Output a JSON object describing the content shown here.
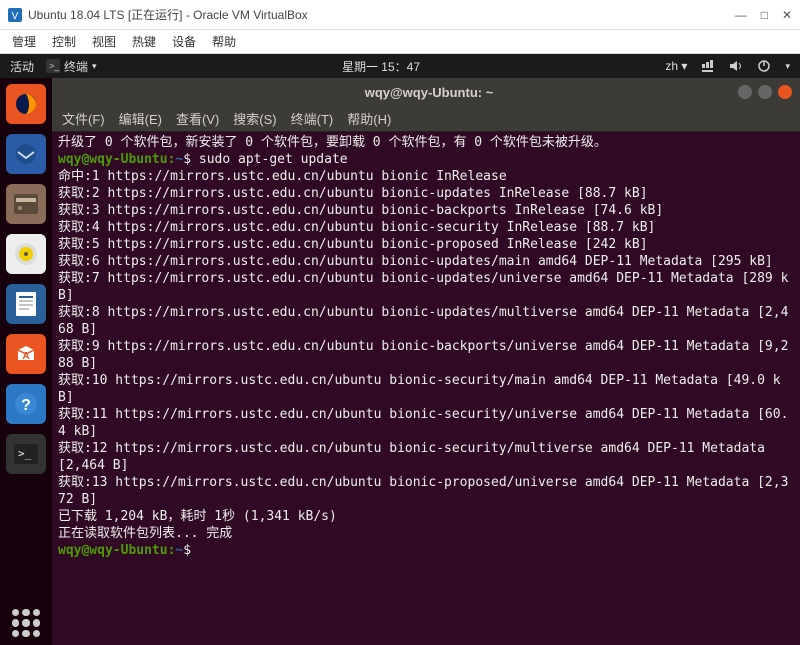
{
  "virtualbox": {
    "title": "Ubuntu 18.04 LTS [正在运行] - Oracle VM VirtualBox",
    "win_min": "—",
    "win_max": "□",
    "win_close": "✕",
    "menus": [
      "管理",
      "控制",
      "视图",
      "热键",
      "设备",
      "帮助"
    ]
  },
  "ubuntu_topbar": {
    "activities": "活动",
    "terminal_label": "终端",
    "clock": "星期一 15：47",
    "input": "zh"
  },
  "launcher_icons": [
    "firefox",
    "thunderbird",
    "files",
    "rhythmbox",
    "writer",
    "software",
    "help",
    "terminal"
  ],
  "term_window": {
    "title": "wqy@wqy-Ubuntu: ~",
    "menus": [
      "文件(F)",
      "编辑(E)",
      "查看(V)",
      "搜索(S)",
      "终端(T)",
      "帮助(H)"
    ]
  },
  "prompt": {
    "user_host": "wqy@wqy-Ubuntu:",
    "path": "~",
    "sep": "$"
  },
  "terminal_lines": [
    {
      "t": "plain",
      "text": "升级了 0 个软件包，新安装了 0 个软件包，要卸载 0 个软件包，有 0 个软件包未被升级。"
    },
    {
      "t": "prompt",
      "cmd": "sudo apt-get update"
    },
    {
      "t": "plain",
      "text": "命中:1 https://mirrors.ustc.edu.cn/ubuntu bionic InRelease"
    },
    {
      "t": "plain",
      "text": "获取:2 https://mirrors.ustc.edu.cn/ubuntu bionic-updates InRelease [88.7 kB]"
    },
    {
      "t": "plain",
      "text": "获取:3 https://mirrors.ustc.edu.cn/ubuntu bionic-backports InRelease [74.6 kB]"
    },
    {
      "t": "plain",
      "text": "获取:4 https://mirrors.ustc.edu.cn/ubuntu bionic-security InRelease [88.7 kB]"
    },
    {
      "t": "plain",
      "text": "获取:5 https://mirrors.ustc.edu.cn/ubuntu bionic-proposed InRelease [242 kB]"
    },
    {
      "t": "plain",
      "text": "获取:6 https://mirrors.ustc.edu.cn/ubuntu bionic-updates/main amd64 DEP-11 Metadata [295 kB]"
    },
    {
      "t": "plain",
      "text": "获取:7 https://mirrors.ustc.edu.cn/ubuntu bionic-updates/universe amd64 DEP-11 Metadata [289 kB]"
    },
    {
      "t": "plain",
      "text": "获取:8 https://mirrors.ustc.edu.cn/ubuntu bionic-updates/multiverse amd64 DEP-11 Metadata [2,468 B]"
    },
    {
      "t": "plain",
      "text": "获取:9 https://mirrors.ustc.edu.cn/ubuntu bionic-backports/universe amd64 DEP-11 Metadata [9,288 B]"
    },
    {
      "t": "plain",
      "text": "获取:10 https://mirrors.ustc.edu.cn/ubuntu bionic-security/main amd64 DEP-11 Metadata [49.0 kB]"
    },
    {
      "t": "plain",
      "text": "获取:11 https://mirrors.ustc.edu.cn/ubuntu bionic-security/universe amd64 DEP-11 Metadata [60.4 kB]"
    },
    {
      "t": "plain",
      "text": "获取:12 https://mirrors.ustc.edu.cn/ubuntu bionic-security/multiverse amd64 DEP-11 Metadata [2,464 B]"
    },
    {
      "t": "plain",
      "text": "获取:13 https://mirrors.ustc.edu.cn/ubuntu bionic-proposed/universe amd64 DEP-11 Metadata [2,372 B]"
    },
    {
      "t": "plain",
      "text": "已下载 1,204 kB，耗时 1秒 (1,341 kB/s)"
    },
    {
      "t": "plain",
      "text": "正在读取软件包列表... 完成"
    },
    {
      "t": "prompt",
      "cmd": ""
    }
  ]
}
